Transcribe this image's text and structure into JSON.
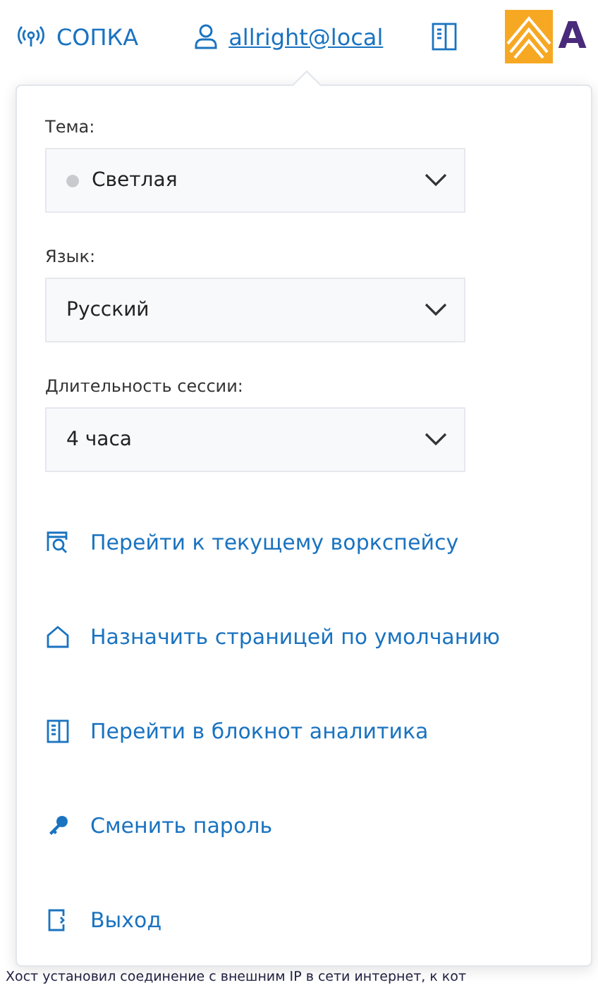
{
  "header": {
    "network": "СОПКА",
    "user": "allright@local",
    "logo_text": "A"
  },
  "settings": [
    {
      "label": "Тема:",
      "value": "Светлая",
      "color": "#c8cacd"
    },
    {
      "label": "Язык:",
      "value": "Русский"
    },
    {
      "label": "Длительность сессии:",
      "value": "4 часа"
    }
  ],
  "actions": [
    {
      "kind": "workspace",
      "label": "Перейти к текущему воркспейсу"
    },
    {
      "kind": "home",
      "label": "Назначить страницей по умолчанию"
    },
    {
      "kind": "notebook",
      "label": "Перейти в блокнот аналитика"
    },
    {
      "kind": "key",
      "label": "Сменить пароль"
    },
    {
      "kind": "logout",
      "label": "Выход"
    }
  ],
  "background_text": "Хост установил соединение с внешним IP в сети интернет, к кот"
}
